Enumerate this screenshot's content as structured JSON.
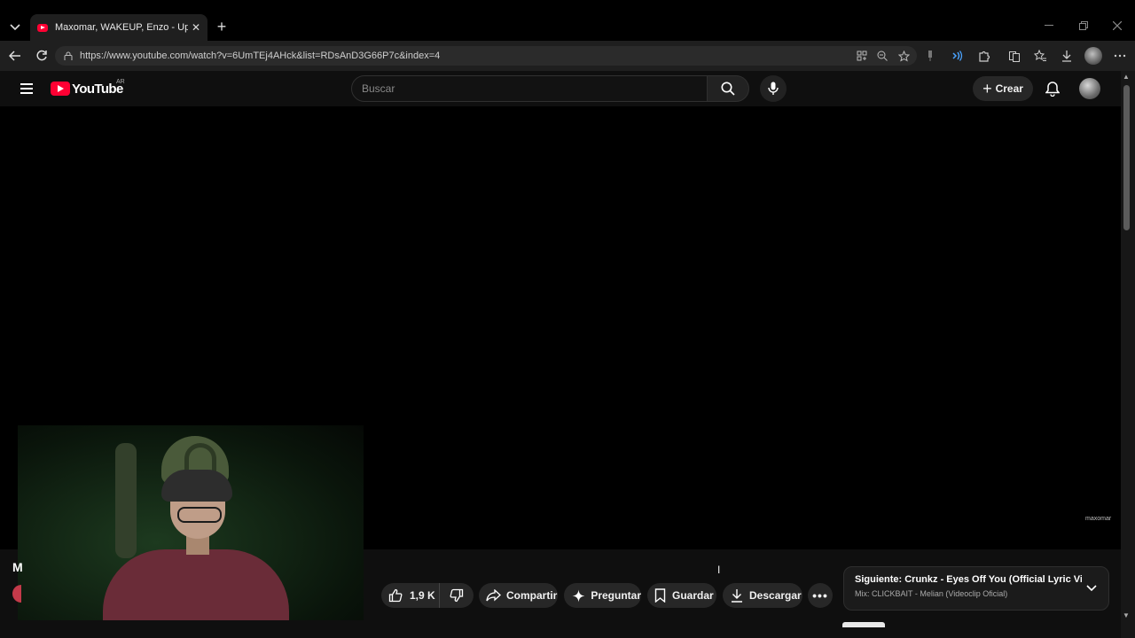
{
  "browser": {
    "tab_title": "Maxomar, WAKEUP, Enzo - Up & D",
    "tab_close": "✕",
    "new_tab": "+",
    "url": "https://www.youtube.com/watch?v=6UmTEj4AHck&list=RDsAnD3G66P7c&index=4"
  },
  "youtube": {
    "logo_text": "YouTube",
    "country_code": "AR",
    "search_placeholder": "Buscar",
    "create_label": "Crear",
    "video_watermark": "maxomar",
    "left_fragment": "M",
    "actions": {
      "like_count": "1,9 K",
      "share": "Compartir",
      "ask": "Preguntar",
      "save": "Guardar",
      "download": "Descargar",
      "more": "•••"
    },
    "up_next": {
      "label": "Siguiente:",
      "title": "Crunkz - Eyes Off You (Official Lyric Video)",
      "mix": "Mix: CLICKBAIT - Melian (Videoclip Oficial)"
    }
  },
  "colors": {
    "brand_red": "#ff0033",
    "background": "#0f0f0f",
    "pill": "#272727"
  }
}
